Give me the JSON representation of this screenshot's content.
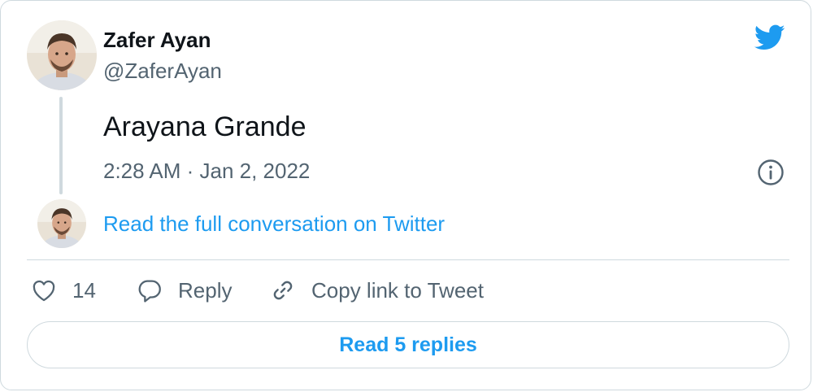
{
  "author": {
    "name": "Zafer Ayan",
    "handle": "@ZaferAyan",
    "avatar_icon": "profile-photo"
  },
  "tweet": {
    "text": "Arayana Grande",
    "timestamp": "2:28 AM · Jan 2, 2022"
  },
  "conversation": {
    "link_label": "Read the full conversation on Twitter"
  },
  "actions": {
    "like_count": "14",
    "reply_label": "Reply",
    "copy_label": "Copy link to Tweet"
  },
  "replies": {
    "button_label": "Read 5 replies"
  },
  "icons": {
    "brand": "twitter-bird-icon",
    "info": "info-icon",
    "like": "heart-icon",
    "reply": "speech-bubble-icon",
    "copy": "link-icon"
  },
  "colors": {
    "accent": "#1d9bf0",
    "text_primary": "#0f1419",
    "text_secondary": "#536471",
    "border": "#cfd9de"
  }
}
